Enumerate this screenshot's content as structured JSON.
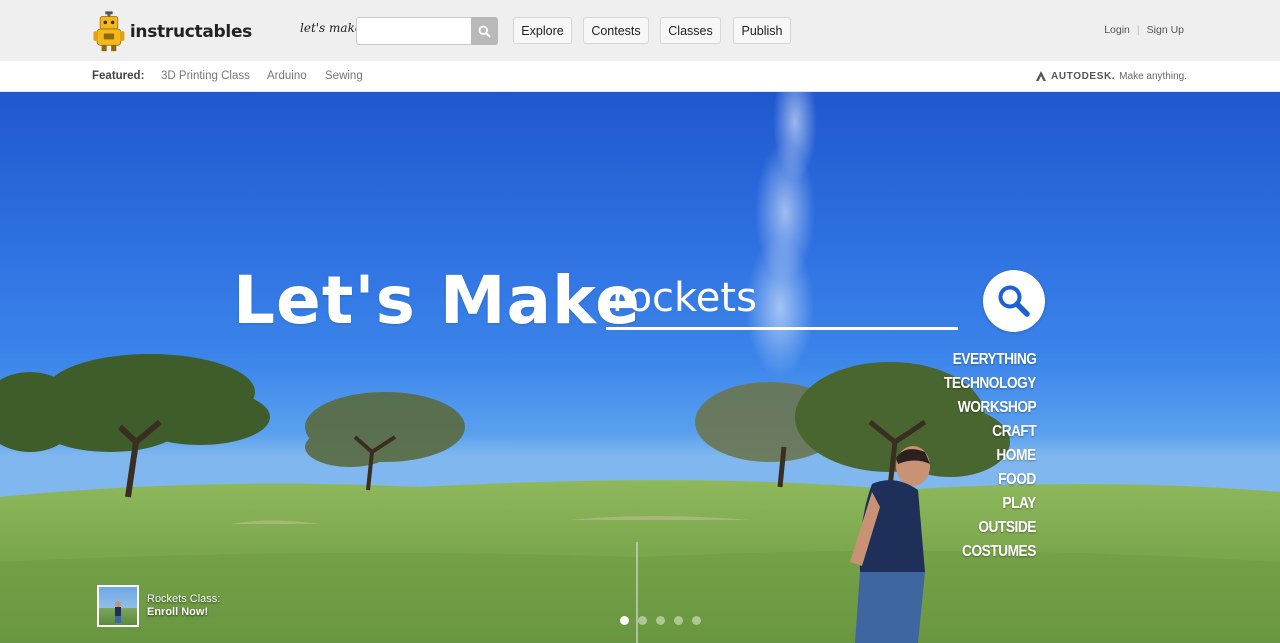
{
  "header": {
    "brand": "instructables",
    "lets_make_small": "let's make",
    "search_value": "",
    "nav": [
      "Explore",
      "Contests",
      "Classes",
      "Publish"
    ],
    "login": "Login",
    "signup": "Sign Up"
  },
  "featured": {
    "label": "Featured:",
    "links": [
      "3D Printing Class",
      "Arduino",
      "Sewing"
    ],
    "partner_brand": "AUTODESK.",
    "partner_tagline": "Make anything."
  },
  "hero": {
    "title": "Let's Make",
    "search_value": "rockets",
    "categories": [
      "EVERYTHING",
      "TECHNOLOGY",
      "WORKSHOP",
      "CRAFT",
      "HOME",
      "FOOD",
      "PLAY",
      "OUTSIDE",
      "COSTUMES"
    ],
    "promo_line1": "Rockets Class:",
    "promo_line2": "Enroll Now!",
    "carousel_active_index": 0,
    "carousel_count": 5
  },
  "colors": {
    "header_bg": "#efefef",
    "sky_top": "#1f58cf",
    "sky_bottom": "#7fb7ee",
    "grass": "#7aa84e",
    "robot_yellow": "#f5b819"
  }
}
